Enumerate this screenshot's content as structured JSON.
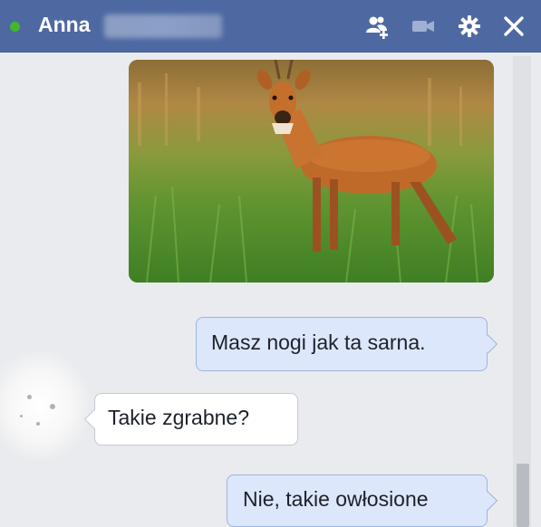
{
  "header": {
    "contact_name": "Anna",
    "status": "online",
    "icons": [
      "add-people-icon",
      "video-call-icon",
      "settings-gear-icon",
      "close-icon"
    ]
  },
  "messages": [
    {
      "sender": "me",
      "type": "image",
      "image_alt": "deer-in-grass-photo"
    },
    {
      "sender": "me",
      "type": "text",
      "text": "Masz nogi jak ta sarna."
    },
    {
      "sender": "contact",
      "type": "text",
      "text": "Takie zgrabne?"
    },
    {
      "sender": "me",
      "type": "text",
      "text": "Nie, takie owłosione"
    }
  ],
  "colors": {
    "header_bg": "#4e69a2",
    "online_dot": "#42b72a",
    "outgoing_bubble": "#dde7fb",
    "incoming_bubble": "#ffffff"
  }
}
